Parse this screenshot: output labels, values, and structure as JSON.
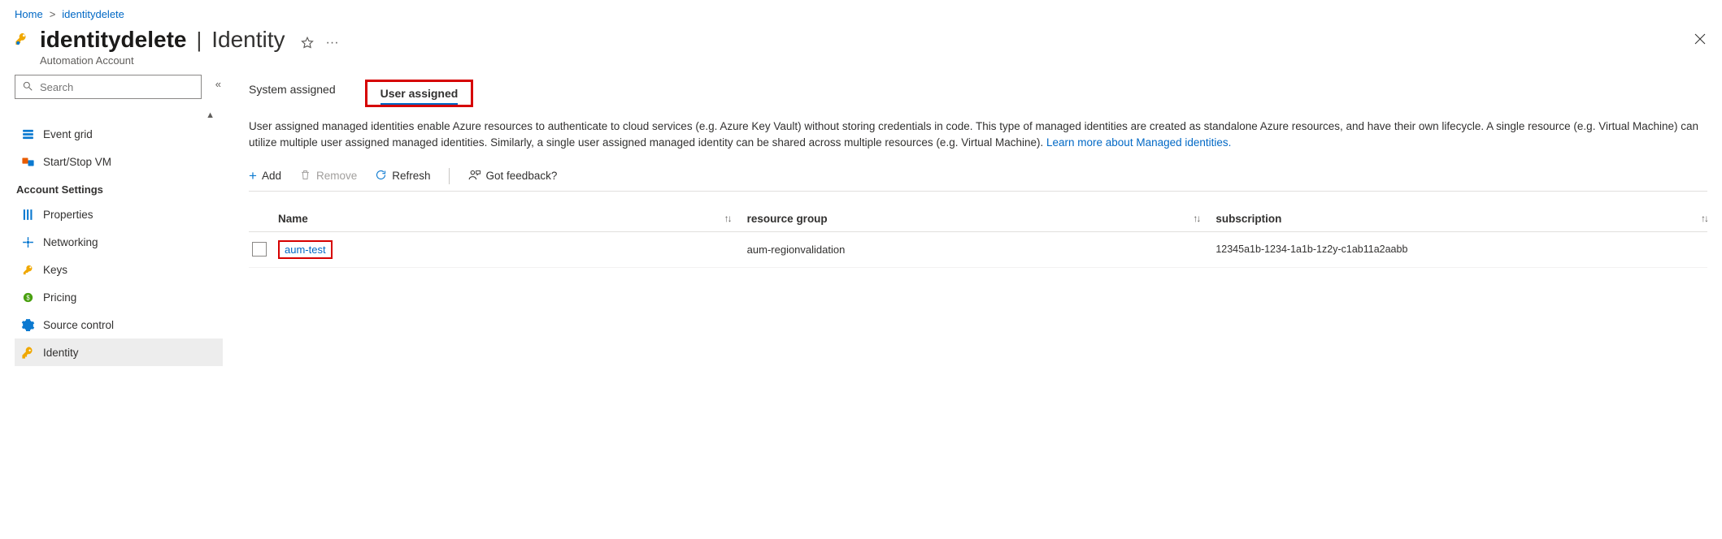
{
  "breadcrumb": {
    "home": "Home",
    "current": "identitydelete"
  },
  "header": {
    "title_main": "identitydelete",
    "title_section": "Identity",
    "subtitle": "Automation Account"
  },
  "sidebar": {
    "search_placeholder": "Search",
    "items_top": [
      {
        "label": "Event grid"
      },
      {
        "label": "Start/Stop VM"
      }
    ],
    "section_heading": "Account Settings",
    "items": [
      {
        "label": "Properties"
      },
      {
        "label": "Networking"
      },
      {
        "label": "Keys"
      },
      {
        "label": "Pricing"
      },
      {
        "label": "Source control"
      },
      {
        "label": "Identity"
      }
    ]
  },
  "tabs": {
    "system": "System assigned",
    "user": "User assigned"
  },
  "description": {
    "text": "User assigned managed identities enable Azure resources to authenticate to cloud services (e.g. Azure Key Vault) without storing credentials in code. This type of managed identities are created as standalone Azure resources, and have their own lifecycle. A single resource (e.g. Virtual Machine) can utilize multiple user assigned managed identities. Similarly, a single user assigned managed identity can be shared across multiple resources (e.g. Virtual Machine). ",
    "link": "Learn more about Managed identities."
  },
  "toolbar": {
    "add": "Add",
    "remove": "Remove",
    "refresh": "Refresh",
    "feedback": "Got feedback?"
  },
  "table": {
    "col_name": "Name",
    "col_rg": "resource group",
    "col_sub": "subscription",
    "rows": [
      {
        "name": "aum-test",
        "rg": "aum-regionvalidation",
        "sub": "12345a1b-1234-1a1b-1z2y-c1ab11a2aabb"
      }
    ]
  }
}
